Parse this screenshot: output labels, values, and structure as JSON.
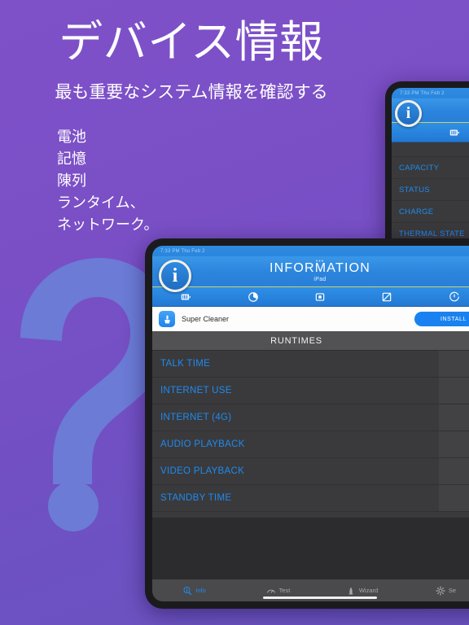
{
  "marketing": {
    "headline": "デバイス情報",
    "subhead": "最も重要なシステム情報を確認する",
    "bullets": [
      "電池",
      "記憶",
      "陳列",
      "ランタイム、",
      "ネットワーク。"
    ]
  },
  "theme": {
    "background_start": "#7f51c9",
    "background_end": "#6a54c0",
    "decoration_color": "#6b7bd6",
    "accent_blue": "#1e8bf0",
    "nav_blue": "#2b84dd"
  },
  "decoration": {
    "shape": "question-mark"
  },
  "small_device": {
    "status_time": "7:33 PM  Thu Feb 2",
    "logo_letter": "i",
    "toolbar_icons": [
      "battery-icon"
    ],
    "rows": [
      {
        "label": "CAPACITY"
      },
      {
        "label": "STATUS"
      },
      {
        "label": "CHARGE"
      },
      {
        "label": "THERMAL STATE"
      }
    ]
  },
  "main_device": {
    "status_time": "7:33 PM  Thu Feb 2",
    "logo_letter": "i",
    "nav": {
      "dots": "•••",
      "title": "INFORMATION",
      "subtitle": "iPad"
    },
    "toolbar_icons": [
      "battery-icon",
      "pie-chart-icon",
      "device-icon",
      "display-icon",
      "clock-icon"
    ],
    "ad": {
      "icon": "broom-icon",
      "name": "Super Cleaner",
      "install_label": "INSTALL"
    },
    "section_title": "RUNTIMES",
    "rows": [
      {
        "label": "TALK TIME",
        "value": ""
      },
      {
        "label": "INTERNET USE",
        "value": ""
      },
      {
        "label": "INTERNET (4G)",
        "value": ""
      },
      {
        "label": "AUDIO PLAYBACK",
        "value": ""
      },
      {
        "label": "VIDEO PLAYBACK",
        "value": ""
      },
      {
        "label": "STANDBY TIME",
        "value": ""
      }
    ],
    "tabs": [
      {
        "label": "Info",
        "icon": "info-search-icon",
        "active": true
      },
      {
        "label": "Test",
        "icon": "gauge-icon",
        "active": false
      },
      {
        "label": "Wizard",
        "icon": "wizard-icon",
        "active": false
      },
      {
        "label": "Se",
        "icon": "gear-icon",
        "active": false
      }
    ]
  }
}
